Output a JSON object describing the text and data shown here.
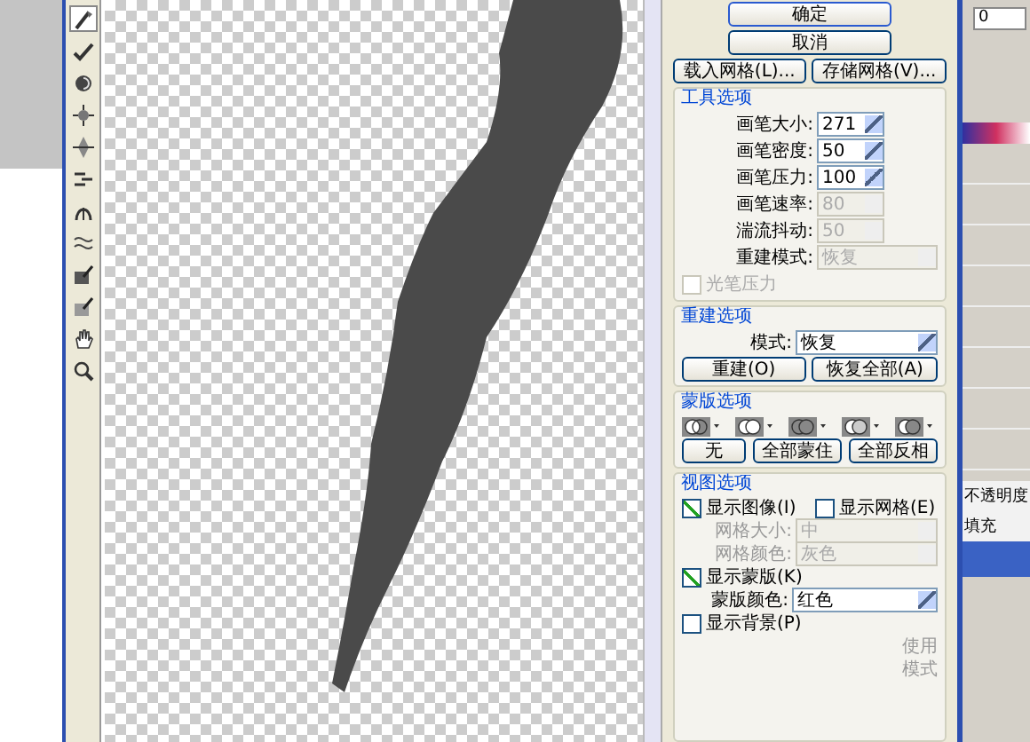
{
  "tools": [
    {
      "kind": "warp",
      "selected": true
    },
    {
      "kind": "reconstruct",
      "selected": false
    },
    {
      "kind": "twirl",
      "selected": false
    },
    {
      "kind": "pucker",
      "selected": false
    },
    {
      "kind": "bloat",
      "selected": false
    },
    {
      "kind": "push",
      "selected": false
    },
    {
      "kind": "mirror",
      "selected": false
    },
    {
      "kind": "turbulence",
      "selected": false
    },
    {
      "kind": "freeze",
      "selected": false
    },
    {
      "kind": "thaw",
      "selected": false
    },
    {
      "kind": "hand",
      "selected": false
    },
    {
      "kind": "zoom",
      "selected": false
    }
  ],
  "buttons": {
    "ok": "确定",
    "cancel": "取消",
    "load_mesh": "载入网格(L)...",
    "save_mesh": "存储网格(V)..."
  },
  "tool_options": {
    "title": "工具选项",
    "fields": [
      {
        "label": "画笔大小:",
        "value": "271",
        "disabled": false
      },
      {
        "label": "画笔密度:",
        "value": "50",
        "disabled": false
      },
      {
        "label": "画笔压力:",
        "value": "100",
        "disabled": false
      },
      {
        "label": "画笔速率:",
        "value": "80",
        "disabled": true
      },
      {
        "label": "湍流抖动:",
        "value": "50",
        "disabled": true
      }
    ],
    "rebuild_mode": {
      "label": "重建模式:",
      "value": "恢复",
      "disabled": true
    },
    "stylus": {
      "label": "光笔压力",
      "checked": false,
      "disabled": true
    }
  },
  "reconstruct_options": {
    "title": "重建选项",
    "mode_label": "模式:",
    "mode_value": "恢复",
    "buttons": [
      "重建(O)",
      "恢复全部(A)"
    ]
  },
  "mask_options": {
    "title": "蒙版选项",
    "mask_modes": [
      {
        "kind": "replace"
      },
      {
        "kind": "add"
      },
      {
        "kind": "subtract"
      },
      {
        "kind": "intersect"
      },
      {
        "kind": "invert"
      }
    ],
    "buttons": [
      "无",
      "全部蒙住",
      "全部反相"
    ]
  },
  "view_options": {
    "title": "视图选项",
    "show_image": {
      "label": "显示图像(I)",
      "checked": true
    },
    "show_mesh": {
      "label": "显示网格(E)",
      "checked": false
    },
    "mesh_size": {
      "label": "网格大小:",
      "value": "中",
      "disabled": true
    },
    "mesh_color": {
      "label": "网格颜色:",
      "value": "灰色",
      "disabled": true
    },
    "show_mask": {
      "label": "显示蒙版(K)",
      "checked": true
    },
    "mask_color": {
      "label": "蒙版颜色:",
      "value": "红色",
      "disabled": false
    },
    "show_backdrop": {
      "label": "显示背景(P)",
      "checked": false
    },
    "backdrop_labels": [
      "使用",
      "模式"
    ]
  },
  "side_panel": {
    "value": "0",
    "opacity_label": "不透明度",
    "fill_label": "填充"
  }
}
